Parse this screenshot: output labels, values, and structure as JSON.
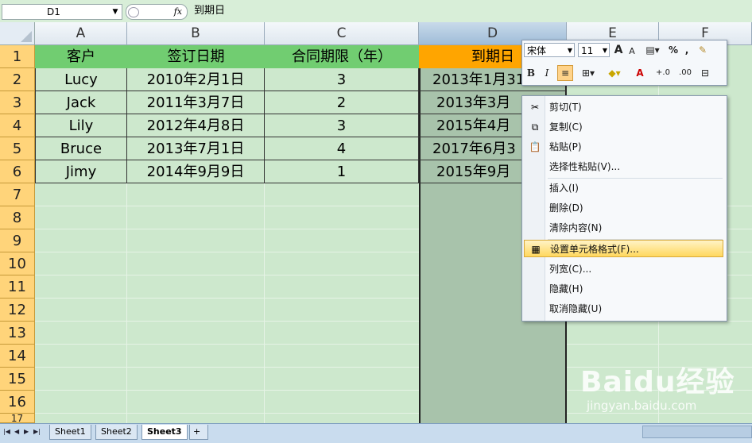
{
  "formula_bar": {
    "name_box": "D1",
    "fx_label": "fx",
    "formula": "到期日"
  },
  "columns": [
    "A",
    "B",
    "C",
    "D",
    "E",
    "F"
  ],
  "rows": [
    "1",
    "2",
    "3",
    "4",
    "5",
    "6",
    "7",
    "8",
    "9",
    "10",
    "11",
    "12",
    "13",
    "14",
    "15",
    "16",
    "17"
  ],
  "table": {
    "header": [
      "客户",
      "签订日期",
      "合同期限（年）",
      "到期日"
    ],
    "rows": [
      [
        "Lucy",
        "2010年2月1日",
        "3",
        "2013年1月31日"
      ],
      [
        "Jack",
        "2011年3月7日",
        "2",
        "2013年3月"
      ],
      [
        "Lily",
        "2012年4月8日",
        "3",
        "2015年4月"
      ],
      [
        "Bruce",
        "2013年7月1日",
        "4",
        "2017年6月3"
      ],
      [
        "Jimy",
        "2014年9月9日",
        "1",
        "2015年9月"
      ]
    ]
  },
  "sheet_tabs": [
    "Sheet1",
    "Sheet2",
    "Sheet3"
  ],
  "active_sheet": "Sheet3",
  "mini_toolbar": {
    "font": "宋体",
    "size": "11",
    "grow": "A",
    "shrink": "A",
    "percent": "%",
    "comma": ",",
    "bold": "B",
    "italic": "I",
    "font_color_glyph": "A",
    "inc_decimal": "+.0",
    "dec_decimal": ".00"
  },
  "context_menu": {
    "items": [
      {
        "label": "剪切(T)",
        "icon": "scissors-icon"
      },
      {
        "label": "复制(C)",
        "icon": "copy-icon"
      },
      {
        "label": "粘贴(P)",
        "icon": "paste-icon"
      },
      {
        "label": "选择性粘贴(V)...",
        "icon": ""
      },
      {
        "label": "插入(I)",
        "icon": ""
      },
      {
        "label": "删除(D)",
        "icon": ""
      },
      {
        "label": "清除内容(N)",
        "icon": ""
      },
      {
        "label": "设置单元格格式(F)...",
        "icon": "format-cells-icon"
      },
      {
        "label": "列宽(C)...",
        "icon": ""
      },
      {
        "label": "隐藏(H)",
        "icon": ""
      },
      {
        "label": "取消隐藏(U)",
        "icon": ""
      }
    ]
  },
  "watermark": {
    "logo": "Baidu经验",
    "url": "jingyan.baidu.com"
  },
  "colors": {
    "header_green": "#71cd71",
    "row_header": "#ffd47a",
    "d1_header": "#ffa500",
    "selection": "#a8c3ab",
    "highlight": "#ffd85e"
  }
}
